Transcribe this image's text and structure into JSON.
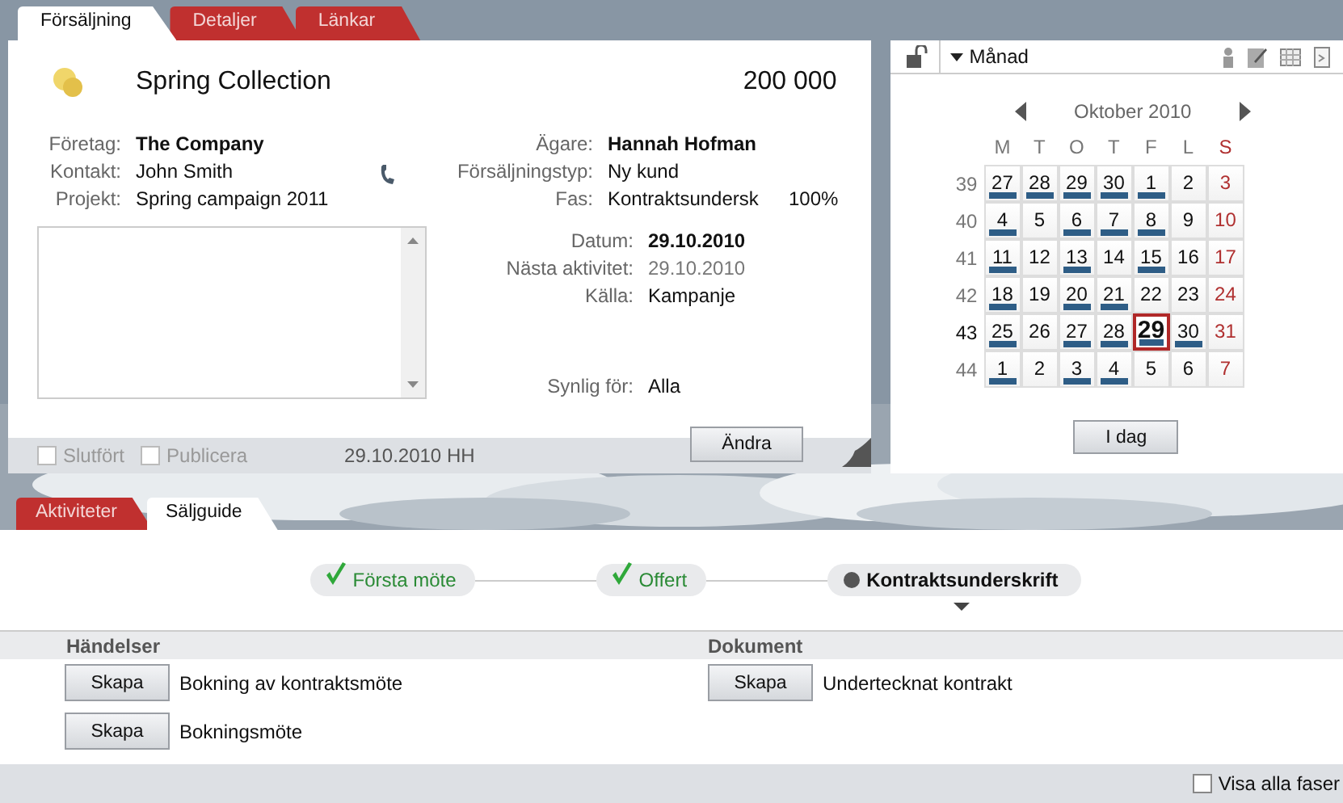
{
  "sale_tabs": [
    {
      "label": "Försäljning",
      "selected": true
    },
    {
      "label": "Detaljer",
      "selected": false
    },
    {
      "label": "Länkar",
      "selected": false
    }
  ],
  "sale": {
    "title": "Spring Collection",
    "amount": "200 000",
    "left_fields": [
      {
        "label": "Företag:",
        "value": "The Company",
        "bold": true,
        "muted": false
      },
      {
        "label": "Kontakt:",
        "value": "John Smith",
        "bold": false,
        "muted": false
      },
      {
        "label": "Projekt:",
        "value": "Spring campaign 2011",
        "bold": false,
        "muted": false
      }
    ],
    "right_fields": [
      {
        "label": "Ägare:",
        "value": "Hannah Hofman",
        "bold": true,
        "muted": false
      },
      {
        "label": "Försäljningstyp:",
        "value": "Ny kund",
        "bold": false,
        "muted": false
      },
      {
        "label": "Fas:",
        "value": "Kontraktsundersk",
        "bold": false,
        "muted": false,
        "extra": "100%"
      }
    ],
    "date_fields": [
      {
        "label": "Datum:",
        "value": "29.10.2010",
        "bold": true,
        "muted": false
      },
      {
        "label": "Nästa aktivitet:",
        "value": "29.10.2010",
        "bold": false,
        "muted": true
      },
      {
        "label": "Källa:",
        "value": "Kampanje",
        "bold": false,
        "muted": false
      }
    ],
    "visibility": {
      "label": "Synlig för:",
      "value": "Alla"
    },
    "footer_checks": [
      {
        "label": "Slutfört",
        "checked": false,
        "disabled": true
      },
      {
        "label": "Publicera",
        "checked": false,
        "disabled": true
      }
    ],
    "footer_stamp": "29.10.2010 HH",
    "edit_button": "Ändra"
  },
  "calendar": {
    "view": "Månad",
    "month": "Oktober 2010",
    "weekdays": [
      "M",
      "T",
      "O",
      "T",
      "F",
      "L",
      "S"
    ],
    "weeks": [
      {
        "number": "39",
        "current": false,
        "days": [
          {
            "day": "27",
            "marked": true,
            "selected": false
          },
          {
            "day": "28",
            "marked": true,
            "selected": false
          },
          {
            "day": "29",
            "marked": true,
            "selected": false
          },
          {
            "day": "30",
            "marked": true,
            "selected": false
          },
          {
            "day": "1",
            "marked": true,
            "selected": false
          },
          {
            "day": "2",
            "marked": false,
            "selected": false
          },
          {
            "day": "3",
            "marked": false,
            "selected": false
          }
        ]
      },
      {
        "number": "40",
        "current": false,
        "days": [
          {
            "day": "4",
            "marked": true,
            "selected": false
          },
          {
            "day": "5",
            "marked": false,
            "selected": false
          },
          {
            "day": "6",
            "marked": true,
            "selected": false
          },
          {
            "day": "7",
            "marked": true,
            "selected": false
          },
          {
            "day": "8",
            "marked": true,
            "selected": false
          },
          {
            "day": "9",
            "marked": false,
            "selected": false
          },
          {
            "day": "10",
            "marked": false,
            "selected": false
          }
        ]
      },
      {
        "number": "41",
        "current": false,
        "days": [
          {
            "day": "11",
            "marked": true,
            "selected": false
          },
          {
            "day": "12",
            "marked": false,
            "selected": false
          },
          {
            "day": "13",
            "marked": true,
            "selected": false
          },
          {
            "day": "14",
            "marked": false,
            "selected": false
          },
          {
            "day": "15",
            "marked": true,
            "selected": false
          },
          {
            "day": "16",
            "marked": false,
            "selected": false
          },
          {
            "day": "17",
            "marked": false,
            "selected": false
          }
        ]
      },
      {
        "number": "42",
        "current": false,
        "days": [
          {
            "day": "18",
            "marked": true,
            "selected": false
          },
          {
            "day": "19",
            "marked": false,
            "selected": false
          },
          {
            "day": "20",
            "marked": true,
            "selected": false
          },
          {
            "day": "21",
            "marked": true,
            "selected": false
          },
          {
            "day": "22",
            "marked": false,
            "selected": false
          },
          {
            "day": "23",
            "marked": false,
            "selected": false
          },
          {
            "day": "24",
            "marked": false,
            "selected": false
          }
        ]
      },
      {
        "number": "43",
        "current": true,
        "days": [
          {
            "day": "25",
            "marked": true,
            "selected": false
          },
          {
            "day": "26",
            "marked": false,
            "selected": false
          },
          {
            "day": "27",
            "marked": true,
            "selected": false
          },
          {
            "day": "28",
            "marked": true,
            "selected": false
          },
          {
            "day": "29",
            "marked": true,
            "selected": true
          },
          {
            "day": "30",
            "marked": true,
            "selected": false
          },
          {
            "day": "31",
            "marked": false,
            "selected": false
          }
        ]
      },
      {
        "number": "44",
        "current": false,
        "days": [
          {
            "day": "1",
            "marked": true,
            "selected": false
          },
          {
            "day": "2",
            "marked": false,
            "selected": false
          },
          {
            "day": "3",
            "marked": true,
            "selected": false
          },
          {
            "day": "4",
            "marked": true,
            "selected": false
          },
          {
            "day": "5",
            "marked": false,
            "selected": false
          },
          {
            "day": "6",
            "marked": false,
            "selected": false
          },
          {
            "day": "7",
            "marked": false,
            "selected": false
          }
        ]
      }
    ],
    "today_button": "I dag"
  },
  "guide_tabs": [
    {
      "label": "Aktiviteter",
      "selected": false
    },
    {
      "label": "Säljguide",
      "selected": true
    }
  ],
  "steps": [
    {
      "label": "Första möte",
      "done": true,
      "current": false
    },
    {
      "label": "Offert",
      "done": true,
      "current": false
    },
    {
      "label": "Kontraktsunderskrift",
      "done": false,
      "current": true
    }
  ],
  "events": {
    "heading": "Händelser",
    "items": [
      {
        "button": "Skapa",
        "label": "Bokning av kontraktsmöte"
      },
      {
        "button": "Skapa",
        "label": "Bokningsmöte"
      }
    ]
  },
  "documents": {
    "heading": "Dokument",
    "items": [
      {
        "button": "Skapa",
        "label": "Undertecknat kontrakt"
      }
    ]
  },
  "show_all_phases": {
    "label": "Visa alla faser",
    "checked": false
  }
}
